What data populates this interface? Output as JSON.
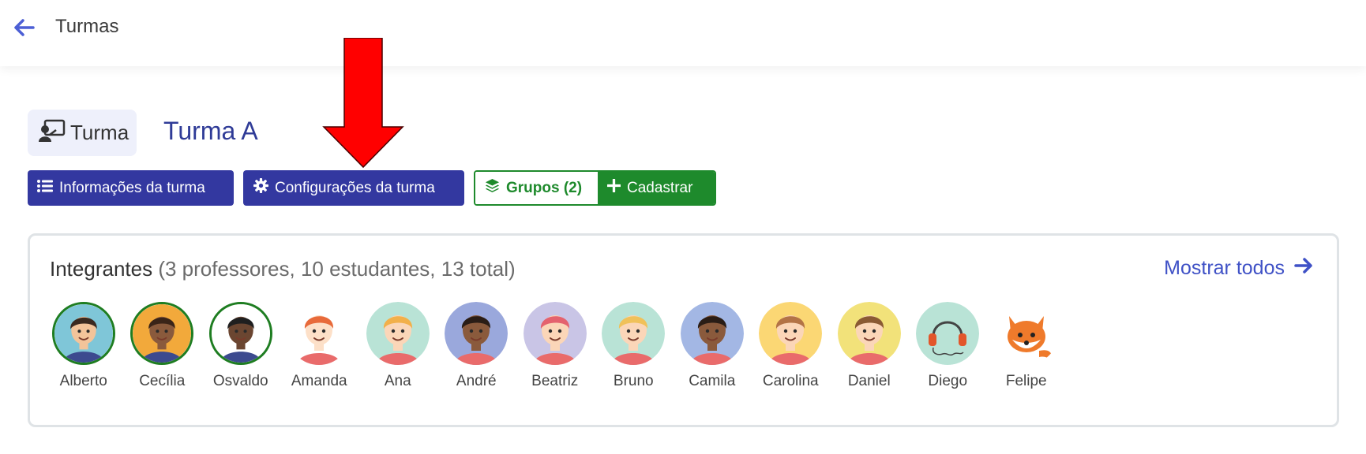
{
  "header": {
    "title": "Turmas"
  },
  "class_tag": {
    "label": "Turma",
    "icon": "teacher-board-icon"
  },
  "class_name": "Turma A",
  "buttons": {
    "info": {
      "label": "Informações da turma",
      "icon": "list-icon"
    },
    "config": {
      "label": "Configurações da turma",
      "icon": "gear-icon"
    },
    "groups": {
      "label": "Grupos (2)",
      "icon": "layers-icon"
    },
    "add": {
      "label": "Cadastrar",
      "icon": "plus-icon"
    }
  },
  "members_panel": {
    "title": "Integrantes",
    "summary": "(3 professores, 10 estudantes, 13 total)",
    "show_all": "Mostrar todos",
    "members": [
      {
        "name": "Alberto",
        "role": "teacher",
        "bg": "#7fc6d8",
        "skin": "#f3c49a",
        "hair": "#3b2a20"
      },
      {
        "name": "Cecília",
        "role": "teacher",
        "bg": "#f2a93b",
        "skin": "#8a5a3c",
        "hair": "#3a2418"
      },
      {
        "name": "Osvaldo",
        "role": "teacher",
        "bg": "#ffffff",
        "skin": "#6b4631",
        "hair": "#1f1f1f"
      },
      {
        "name": "Amanda",
        "role": "student",
        "bg": "#ffffff",
        "skin": "#fde0c8",
        "hair": "#e86a3a"
      },
      {
        "name": "Ana",
        "role": "student",
        "bg": "#b9e3d6",
        "skin": "#fbd6b8",
        "hair": "#f2b04a"
      },
      {
        "name": "André",
        "role": "student",
        "bg": "#9aa8dc",
        "skin": "#8a5a3c",
        "hair": "#2a1d16"
      },
      {
        "name": "Beatriz",
        "role": "student",
        "bg": "#c9c5e6",
        "skin": "#fbd6b8",
        "hair": "#e4626e"
      },
      {
        "name": "Bruno",
        "role": "student",
        "bg": "#b9e3d6",
        "skin": "#fbd6b8",
        "hair": "#f0c15a"
      },
      {
        "name": "Camila",
        "role": "student",
        "bg": "#a3b7e4",
        "skin": "#8a5a3c",
        "hair": "#2a1d16"
      },
      {
        "name": "Carolina",
        "role": "student",
        "bg": "#fbd774",
        "skin": "#fbd6b8",
        "hair": "#b37346"
      },
      {
        "name": "Daniel",
        "role": "student",
        "bg": "#f2e27a",
        "skin": "#fbd6b8",
        "hair": "#8a5a33"
      },
      {
        "name": "Diego",
        "role": "student",
        "bg": "#b9e3d6",
        "skin": "#b9e3d6",
        "hair": "#e2562a"
      },
      {
        "name": "Felipe",
        "role": "student",
        "bg": "#ffffff",
        "skin": "#ffffff",
        "hair": "#ef7a2b"
      }
    ]
  },
  "colors": {
    "primary": "#3338a0",
    "success": "#1e8a2c",
    "link": "#3f51c6",
    "annotation_arrow": "#ff0000"
  }
}
